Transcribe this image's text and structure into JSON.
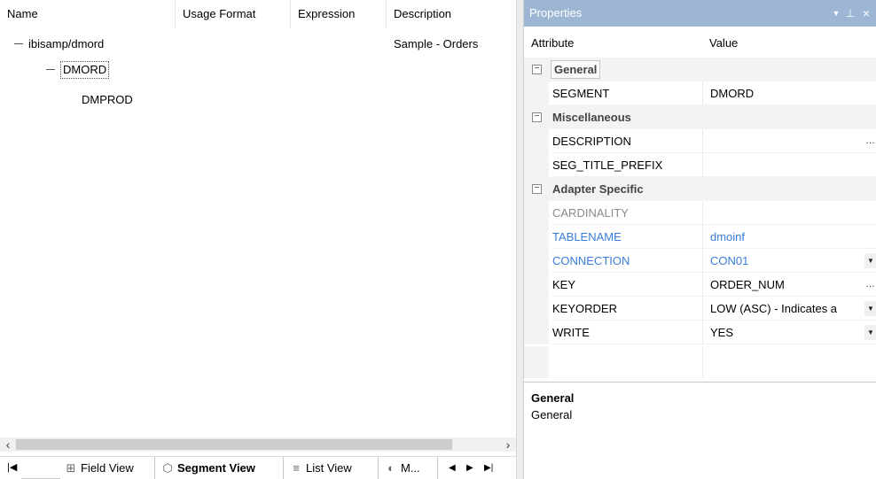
{
  "left": {
    "columns": {
      "name": "Name",
      "usage_format": "Usage Format",
      "expression": "Expression",
      "description": "Description"
    },
    "tree": {
      "root_label": "ibisamp/dmord",
      "root_description": "Sample - Orders",
      "segment_label": "DMORD",
      "child_label": "DMPROD"
    },
    "tabs": {
      "field_view": "Field View",
      "segment_view": "Segment View",
      "list_view": "List View",
      "m_tab": "M..."
    }
  },
  "properties": {
    "title": "Properties",
    "header": {
      "attribute": "Attribute",
      "value": "Value"
    },
    "categories": {
      "general": "General",
      "misc": "Miscellaneous",
      "adapter": "Adapter Specific"
    },
    "rows": {
      "segment": {
        "name": "SEGMENT",
        "value": "DMORD"
      },
      "description": {
        "name": "DESCRIPTION",
        "value": ""
      },
      "seg_title_prefix": {
        "name": "SEG_TITLE_PREFIX",
        "value": ""
      },
      "cardinality": {
        "name": "CARDINALITY",
        "value": ""
      },
      "tablename": {
        "name": "TABLENAME",
        "value": "dmoinf"
      },
      "connection": {
        "name": "CONNECTION",
        "value": "CON01"
      },
      "key": {
        "name": "KEY",
        "value": "ORDER_NUM"
      },
      "keyorder": {
        "name": "KEYORDER",
        "value": "LOW (ASC) - Indicates a"
      },
      "write": {
        "name": "WRITE",
        "value": "YES"
      }
    },
    "desc_title": "General",
    "desc_text": "General"
  },
  "colors": {
    "title_bar": "#9cb6d3",
    "link_blue": "#3a7dd8",
    "disabled_gray": "#8a8a8a"
  }
}
